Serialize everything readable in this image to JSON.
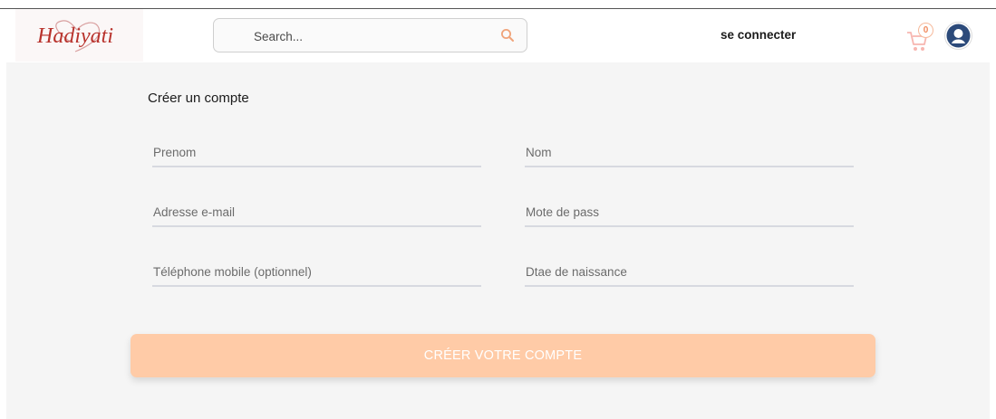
{
  "header": {
    "logo_text": "Hadiyati",
    "search": {
      "placeholder": "Search..."
    },
    "login_label": "se connecter",
    "cart": {
      "count": "0"
    }
  },
  "form": {
    "title": "Créer un compte",
    "fields": {
      "first_name": "Prenom",
      "last_name": "Nom",
      "email": "Adresse e-mail",
      "password": "Mote de pass",
      "phone": "Téléphone mobile (optionnel)",
      "birth_date": "Dtae de naissance"
    },
    "submit_label": "CRÉER VOTRE COMPTE"
  },
  "colors": {
    "accent": "#ffcba7",
    "brand": "#c0392b",
    "avatar": "#2c4a7a",
    "badge": "#f08a5d"
  }
}
